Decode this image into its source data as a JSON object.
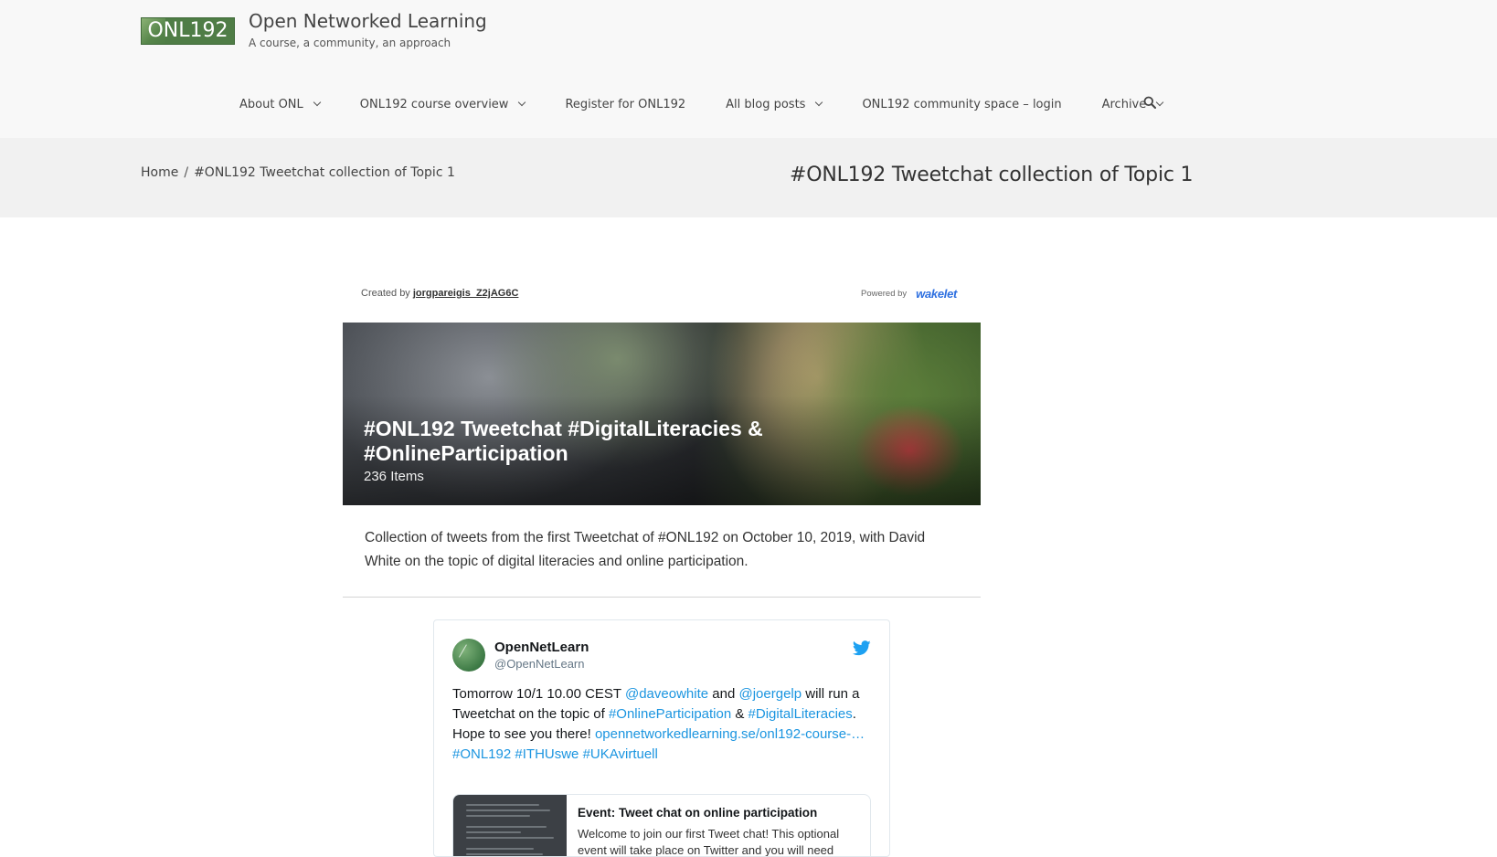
{
  "site": {
    "logo_text": "ONL192",
    "title": "Open Networked Learning",
    "tagline": "A course, a community, an approach"
  },
  "nav": {
    "items": [
      {
        "label": "About ONL",
        "has_dropdown": true
      },
      {
        "label": "ONL192 course overview",
        "has_dropdown": true
      },
      {
        "label": "Register for ONL192",
        "has_dropdown": false
      },
      {
        "label": "All blog posts",
        "has_dropdown": true
      },
      {
        "label": "ONL192 community space – login",
        "has_dropdown": false
      },
      {
        "label": "Archive",
        "has_dropdown": true
      }
    ],
    "search_icon": "search-icon"
  },
  "breadcrumb": {
    "home": "Home",
    "separator": "/",
    "current": "#ONL192 Tweetchat collection of Topic 1"
  },
  "page_title": "#ONL192 Tweetchat collection of Topic 1",
  "wakelet": {
    "created_by_label": "Created by",
    "creator": "jorgpareigis_Z2jAG6C",
    "powered_by_label": "Powered by",
    "brand": "wakelet",
    "brand_color": "#2d6fe0",
    "collection_title": "#ONL192 Tweetchat #DigitalLiteracies & #OnlineParticipation",
    "item_count": "236 Items",
    "description": "Collection of tweets from the first Tweetchat of #ONL192 on October 10, 2019, with David White on the topic of digital literacies and online participation."
  },
  "tweet": {
    "name": "OpenNetLearn",
    "handle": "@OpenNetLearn",
    "text_parts": {
      "t1": "Tomorrow 10/1 10.00 CEST ",
      "l1": "@daveowhite",
      "t2": " and ",
      "l2": "@joergelp",
      "t3": " will run a Tweetchat on the topic of ",
      "l3": "#OnlineParticipation",
      "t4": " & ",
      "l4": "#DigitalLiteracies",
      "t5": ". Hope to see you there! ",
      "l5": "opennetworkedlearning.se/onl192-course-…",
      "t6": " ",
      "l6": "#ONL192",
      "t7": " ",
      "l7": "#ITHUswe",
      "t8": " ",
      "l8": "#UKAvirtuell"
    },
    "link_color": "#1b95e0",
    "card": {
      "title": "Event: Tweet chat on online participation",
      "text": "Welcome to join our first Tweet chat! This optional event will take place on Twitter and you will need"
    }
  },
  "colors": {
    "header_bg": "#f8f8f8",
    "band_bg": "#f1f1f1",
    "logo_bg": "#4f7d46",
    "twitter_blue": "#1da1f2"
  }
}
